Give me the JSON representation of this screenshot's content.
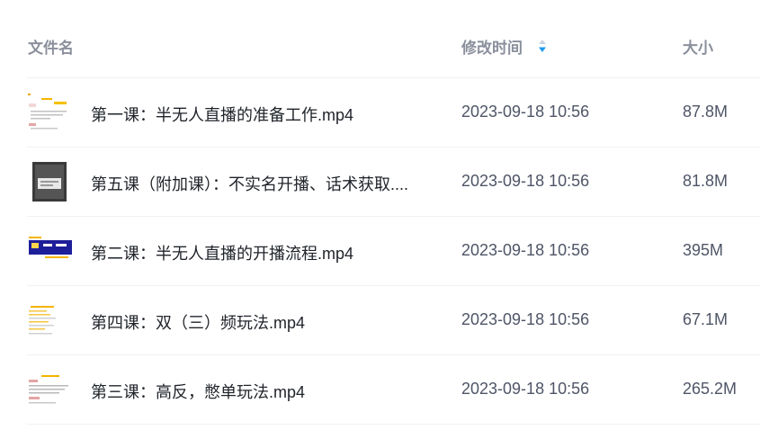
{
  "header": {
    "name_label": "文件名",
    "time_label": "修改时间",
    "size_label": "大小",
    "sort_icon": "sort-icon"
  },
  "files": [
    {
      "name": "第一课：半无人直播的准备工作.mp4",
      "time": "2023-09-18 10:56",
      "size": "87.8M",
      "thumb": "doc-thumbnail"
    },
    {
      "name": "第五课（附加课）：不实名开播、话术获取....",
      "time": "2023-09-18 10:56",
      "size": "81.8M",
      "thumb": "phone-screenshot-thumbnail"
    },
    {
      "name": "第二课：半无人直播的开播流程.mp4",
      "time": "2023-09-18 10:56",
      "size": "395M",
      "thumb": "stream-screenshot-thumbnail"
    },
    {
      "name": "第四课：双（三）频玩法.mp4",
      "time": "2023-09-18 10:56",
      "size": "67.1M",
      "thumb": "doc-thumbnail"
    },
    {
      "name": "第三课：高反，憋单玩法.mp4",
      "time": "2023-09-18 10:56",
      "size": "265.2M",
      "thumb": "doc-thumbnail"
    }
  ],
  "colors": {
    "header_text": "#8a8f9c",
    "name_text": "#1f2329",
    "meta_text": "#4e5566",
    "divider": "#f0f1f4",
    "sort_accent": "#1e9bf0"
  }
}
